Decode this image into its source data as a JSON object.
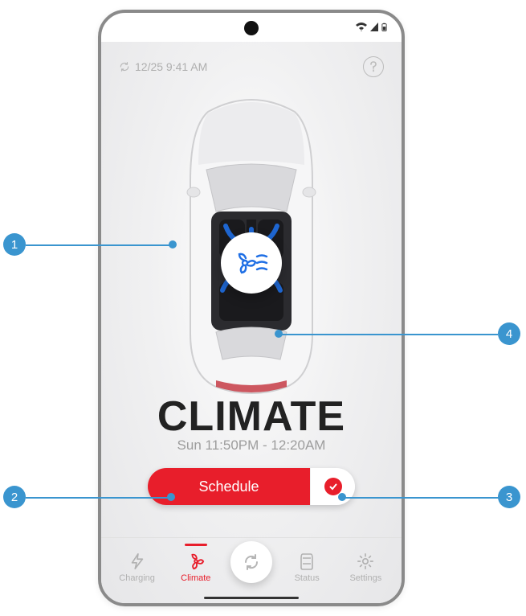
{
  "statusBar": {
    "notch": true
  },
  "header": {
    "timestamp": "12/25 9:41 AM"
  },
  "main": {
    "title": "CLIMATE",
    "subtitle": "Sun 11:50PM - 12:20AM"
  },
  "scheduleButton": {
    "label": "Schedule"
  },
  "tabs": {
    "charging": "Charging",
    "climate": "Climate",
    "status": "Status",
    "settings": "Settings"
  },
  "callouts": {
    "c1": "1",
    "c2": "2",
    "c3": "3",
    "c4": "4"
  }
}
